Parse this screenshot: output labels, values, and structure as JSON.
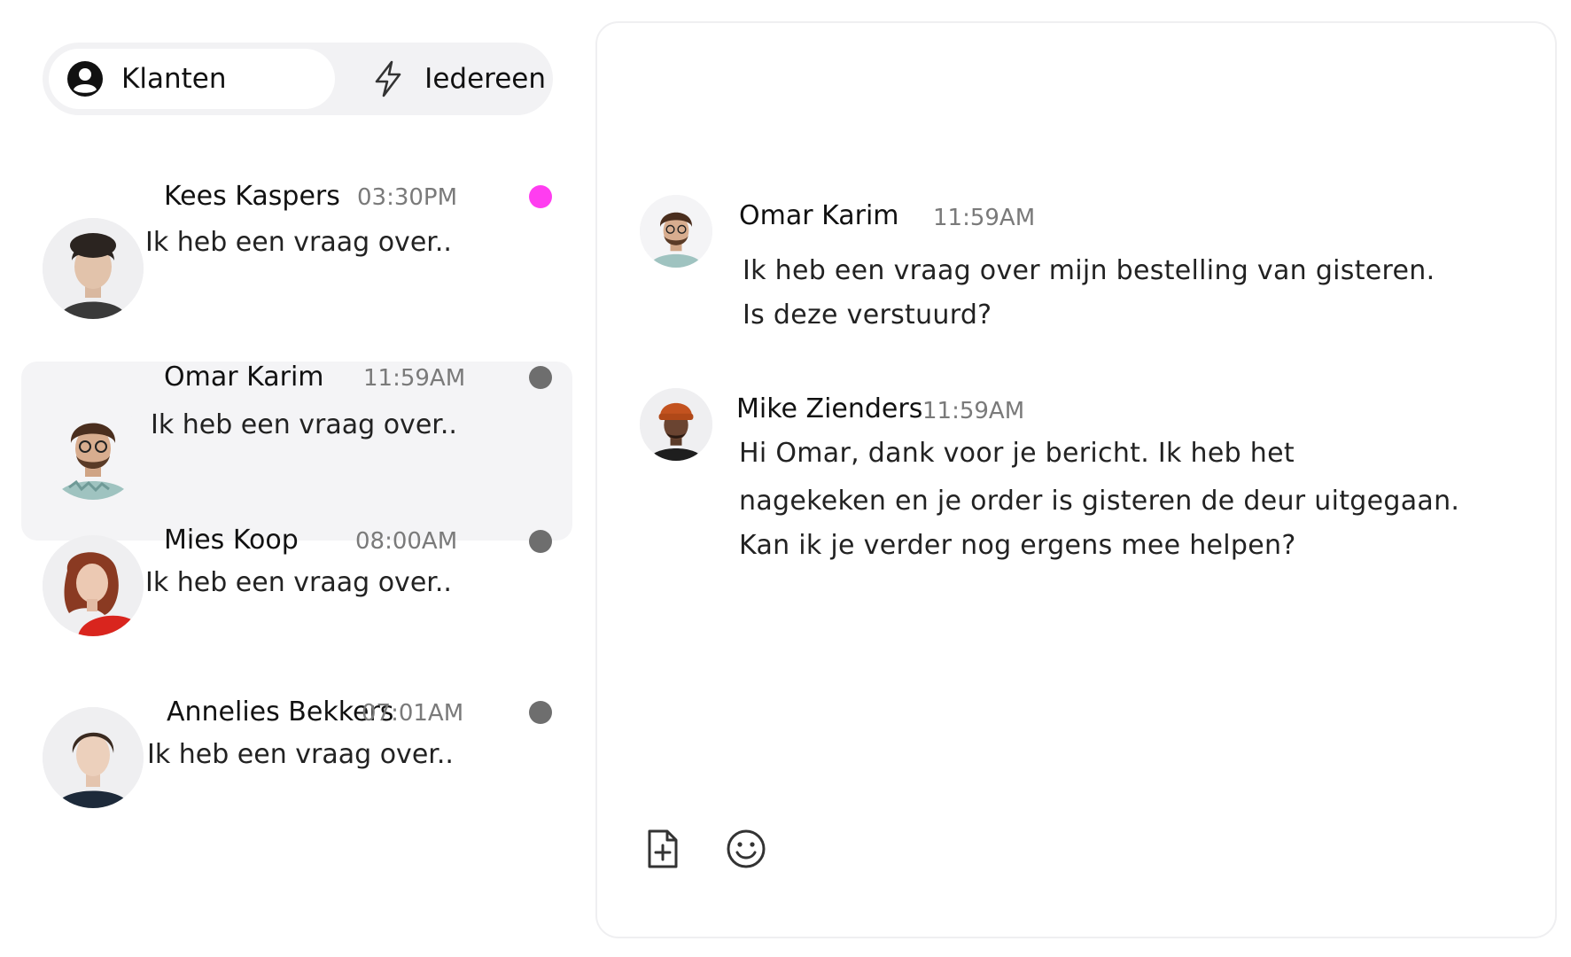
{
  "tabs": [
    {
      "label": "Klanten",
      "icon": "user-circle-icon",
      "active": true
    },
    {
      "label": "Iedereen",
      "icon": "lightning-icon",
      "active": false
    }
  ],
  "conversations": [
    {
      "name": "Kees Kaspers",
      "time": "03:30PM",
      "preview": "Ik heb een vraag over..",
      "status_color": "#ff3df0",
      "unread": true
    },
    {
      "name": "Omar Karim",
      "time": "11:59AM",
      "preview": "Ik heb een vraag over..",
      "status_color": "#6e6e6e",
      "selected": true
    },
    {
      "name": "Mies Koop",
      "time": "08:00AM",
      "preview": "Ik heb een vraag over..",
      "status_color": "#6e6e6e"
    },
    {
      "name": "Annelies Bekkers",
      "time": "07:01AM",
      "preview": "Ik heb een vraag over..",
      "status_color": "#6e6e6e"
    }
  ],
  "messages": [
    {
      "sender": "Omar Karim",
      "time": "11:59AM",
      "lines": [
        "Ik heb een vraag over mijn bestelling van gisteren.",
        "Is deze verstuurd?"
      ]
    },
    {
      "sender": "Mike Zienders",
      "time": "11:59AM",
      "lines": [
        "Hi Omar, dank voor je bericht. Ik heb het",
        "nagekeken en je order is gisteren de deur uitgegaan.",
        "Kan ik je verder nog  ergens mee helpen?"
      ]
    }
  ],
  "composer": {
    "tools": [
      {
        "icon": "add-file-icon"
      },
      {
        "icon": "emoji-icon"
      }
    ]
  },
  "colors": {
    "accent_unread": "#ff3df0",
    "status_default": "#6e6e6e",
    "selected_row_bg": "#f4f4f6",
    "tab_track_bg": "#f2f2f4"
  }
}
